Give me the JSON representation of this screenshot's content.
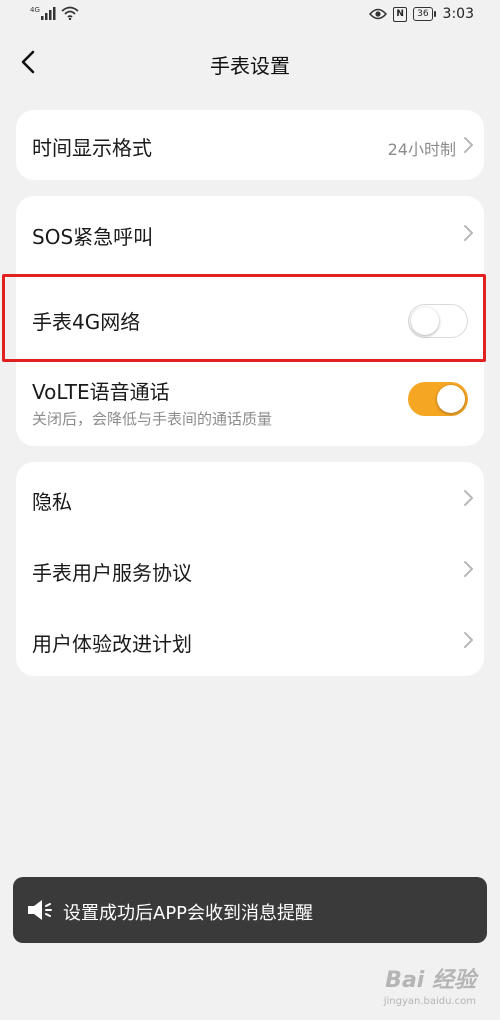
{
  "status_bar": {
    "network": "4G",
    "battery": "36",
    "time": "3:03"
  },
  "nav": {
    "title": "手表设置"
  },
  "settings": {
    "time_format": {
      "label": "时间显示格式",
      "value": "24小时制"
    },
    "sos": {
      "label": "SOS紧急呼叫"
    },
    "watch_4g": {
      "label": "手表4G网络",
      "enabled": false
    },
    "volte": {
      "label": "VoLTE语音通话",
      "sub": "关闭后，会降低与手表间的通话质量",
      "enabled": true
    },
    "privacy": {
      "label": "隐私"
    },
    "agreement": {
      "label": "手表用户服务协议"
    },
    "ux_program": {
      "label": "用户体验改进计划"
    }
  },
  "toast": {
    "text": "设置成功后APP会收到消息提醒"
  },
  "watermark": {
    "logo": "Bai 经验",
    "sub": "jingyan.baidu.com"
  },
  "colors": {
    "accent": "#f5a623",
    "highlight": "#e0211f",
    "background": "#f1f1f1"
  }
}
